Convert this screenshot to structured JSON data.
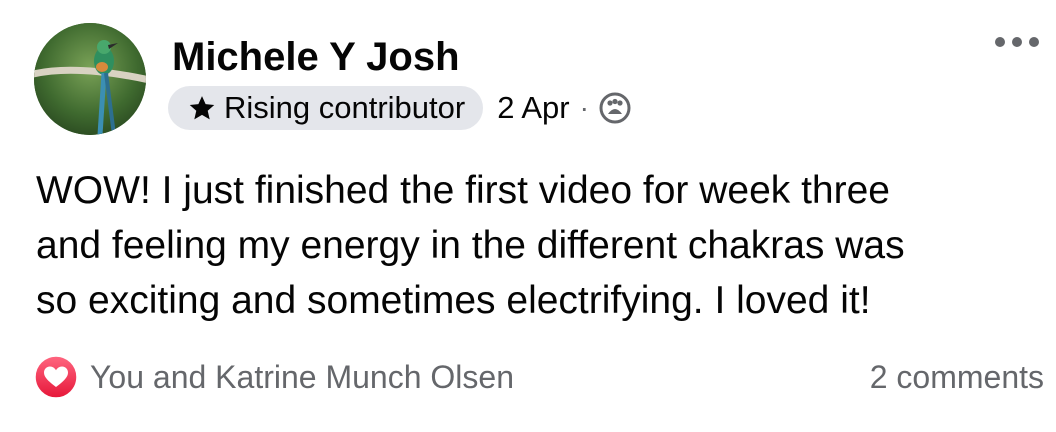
{
  "post": {
    "author": "Michele Y Josh",
    "badge": "Rising contributor",
    "date": "2 Apr",
    "separator": "·",
    "audience_icon": "group-icon",
    "text_lines": [
      "WOW! I just finished the first video for week three",
      "and feeling my energy in the different chakras was",
      "so exciting and sometimes electrifying. I loved it!"
    ],
    "reactions": {
      "icon": "heart-reaction-icon",
      "summary": "You and Katrine Munch Olsen"
    },
    "comments": "2 comments"
  },
  "colors": {
    "badge_bg": "#e4e6eb",
    "secondary_text": "#65676b",
    "heart_red": "#f33e58",
    "primary_text": "#050505"
  }
}
